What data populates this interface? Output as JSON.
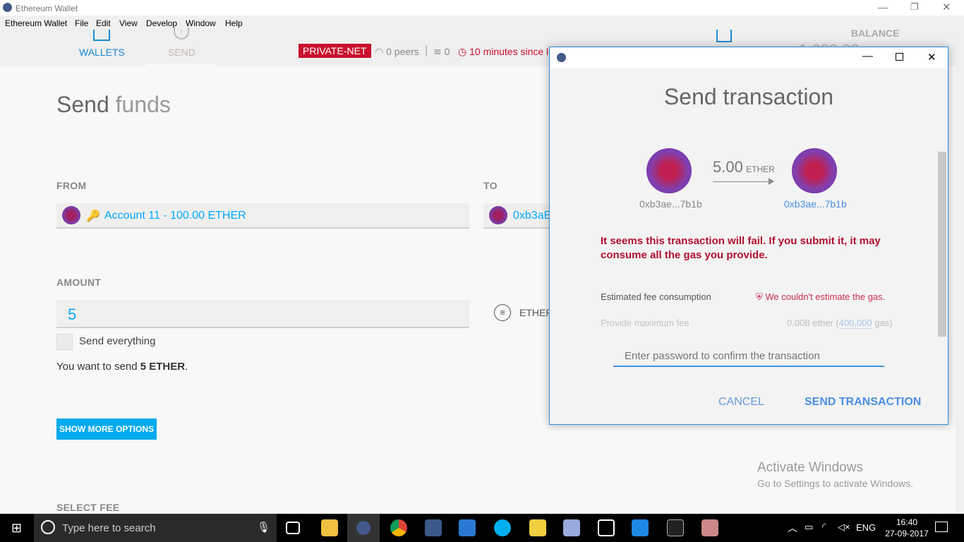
{
  "window": {
    "title": "Ethereum Wallet"
  },
  "menu": [
    "Ethereum Wallet",
    "File",
    "Edit",
    "View",
    "Develop",
    "Window",
    "Help"
  ],
  "header": {
    "wallets": "WALLETS",
    "send": "SEND",
    "network": "PRIVATE-NET",
    "peers": "0 peers",
    "blocks": "0",
    "sync": "10 minutes since l",
    "balance_label": "BALANCE",
    "balance_value": "1,000.00"
  },
  "main": {
    "title_strong": "Send",
    "title_rest": "funds",
    "from_label": "FROM",
    "from_value": "Account 11 - 100.00 ETHER",
    "to_label": "TO",
    "to_value": "0xb3aE",
    "amount_label": "AMOUNT",
    "amount_value": "5",
    "currency": "ETHER",
    "send_everything": "Send everything",
    "want_prefix": "You want to send ",
    "want_amount": "5 ETHER",
    "want_suffix": ".",
    "more_options": "SHOW MORE OPTIONS",
    "select_fee": "SELECT FEE"
  },
  "modal": {
    "title": "Send transaction",
    "amount": "5.00",
    "unit": "ETHER",
    "from_addr": "0xb3ae...7b1b",
    "to_addr": "0xb3ae...7b1b",
    "warning": "It seems this transaction will fail. If you submit it, it may consume all the gas you provide.",
    "fee_label": "Estimated fee consumption",
    "fee_value": "We couldn't estimate the gas.",
    "max_fee_label": "Provide maximum fee",
    "max_fee_ether": "0.008 ether (",
    "max_fee_gas": "400,000",
    "max_fee_suffix": " gas)",
    "password_placeholder": "Enter password to confirm the transaction",
    "cancel": "CANCEL",
    "send": "SEND TRANSACTION"
  },
  "watermark": {
    "line1": "Activate Windows",
    "line2": "Go to Settings to activate Windows."
  },
  "taskbar": {
    "search": "Type here to search",
    "lang": "ENG",
    "time": "16:40",
    "date": "27-09-2017"
  },
  "colors": {
    "accent": "#00aaff",
    "danger": "#c8102e",
    "modal_blue": "#4a90e2"
  }
}
